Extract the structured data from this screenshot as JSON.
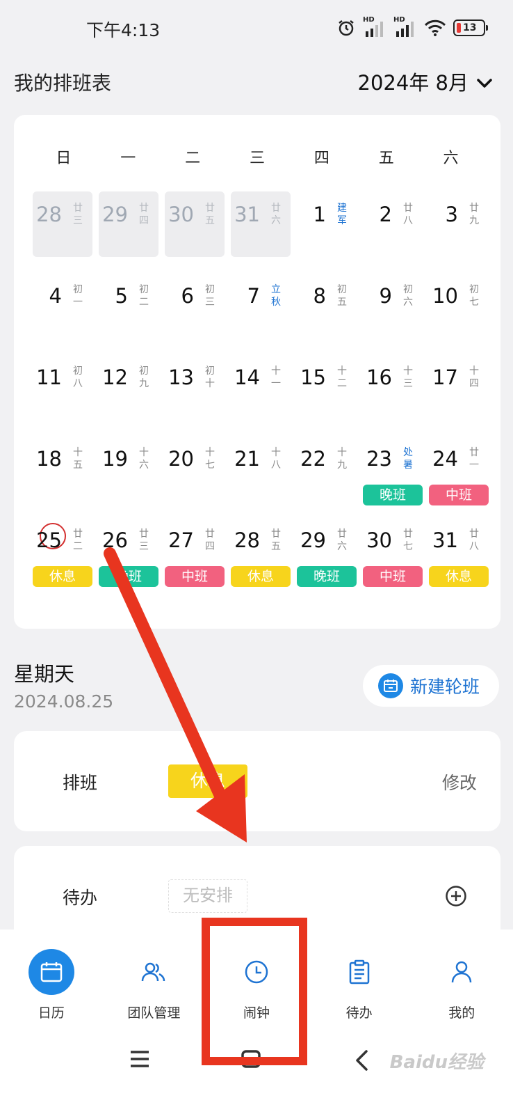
{
  "status": {
    "time": "下午4:13",
    "signal_label_1": "HD",
    "signal_label_2": "HD",
    "battery": "13"
  },
  "header": {
    "title": "我的排班表",
    "month": "2024年 8月"
  },
  "calendar": {
    "weekdays": [
      "日",
      "一",
      "二",
      "三",
      "四",
      "五",
      "六"
    ],
    "days": [
      {
        "num": "28",
        "lunar": "廿三",
        "other": true
      },
      {
        "num": "29",
        "lunar": "廿四",
        "other": true
      },
      {
        "num": "30",
        "lunar": "廿五",
        "other": true
      },
      {
        "num": "31",
        "lunar": "廿六",
        "other": true
      },
      {
        "num": "1",
        "lunar": "建军",
        "term": true
      },
      {
        "num": "2",
        "lunar": "廿八"
      },
      {
        "num": "3",
        "lunar": "廿九"
      },
      {
        "num": "4",
        "lunar": "初一"
      },
      {
        "num": "5",
        "lunar": "初二"
      },
      {
        "num": "6",
        "lunar": "初三"
      },
      {
        "num": "7",
        "lunar": "立秋",
        "term": true
      },
      {
        "num": "8",
        "lunar": "初五"
      },
      {
        "num": "9",
        "lunar": "初六"
      },
      {
        "num": "10",
        "lunar": "初七"
      },
      {
        "num": "11",
        "lunar": "初八"
      },
      {
        "num": "12",
        "lunar": "初九"
      },
      {
        "num": "13",
        "lunar": "初十"
      },
      {
        "num": "14",
        "lunar": "十一"
      },
      {
        "num": "15",
        "lunar": "十二"
      },
      {
        "num": "16",
        "lunar": "十三"
      },
      {
        "num": "17",
        "lunar": "十四"
      },
      {
        "num": "18",
        "lunar": "十五"
      },
      {
        "num": "19",
        "lunar": "十六"
      },
      {
        "num": "20",
        "lunar": "十七"
      },
      {
        "num": "21",
        "lunar": "十八"
      },
      {
        "num": "22",
        "lunar": "十九"
      },
      {
        "num": "23",
        "lunar": "处暑",
        "term": true,
        "shift": "晚班",
        "color": "#1cc39a"
      },
      {
        "num": "24",
        "lunar": "廿一",
        "shift": "中班",
        "color": "#f2617f"
      },
      {
        "num": "25",
        "lunar": "廿二",
        "today": true,
        "shift": "休息",
        "color": "#f7d41c"
      },
      {
        "num": "26",
        "lunar": "廿三",
        "shift": "晚班",
        "color": "#1cc39a"
      },
      {
        "num": "27",
        "lunar": "廿四",
        "shift": "中班",
        "color": "#f2617f"
      },
      {
        "num": "28",
        "lunar": "廿五",
        "shift": "休息",
        "color": "#f7d41c"
      },
      {
        "num": "29",
        "lunar": "廿六",
        "shift": "晚班",
        "color": "#1cc39a"
      },
      {
        "num": "30",
        "lunar": "廿七",
        "shift": "中班",
        "color": "#f2617f"
      },
      {
        "num": "31",
        "lunar": "廿八",
        "shift": "休息",
        "color": "#f7d41c"
      }
    ]
  },
  "selected": {
    "weekday": "星期天",
    "date": "2024.08.25",
    "new_rotation": "新建轮班"
  },
  "schedule_card": {
    "label": "排班",
    "tag": "休息",
    "edit": "修改"
  },
  "todo_card": {
    "label": "待办",
    "empty": "无安排"
  },
  "tabs": [
    {
      "label": "日历",
      "icon": "calendar-icon"
    },
    {
      "label": "团队管理",
      "icon": "team-icon"
    },
    {
      "label": "闹钟",
      "icon": "clock-icon"
    },
    {
      "label": "待办",
      "icon": "clipboard-icon"
    },
    {
      "label": "我的",
      "icon": "user-icon"
    }
  ],
  "watermark": "Baidu经验",
  "colors": {
    "accent": "#1e88e5",
    "rest": "#f7d41c",
    "evening": "#1cc39a",
    "middle": "#f2617f",
    "annotation": "#e8351f"
  }
}
